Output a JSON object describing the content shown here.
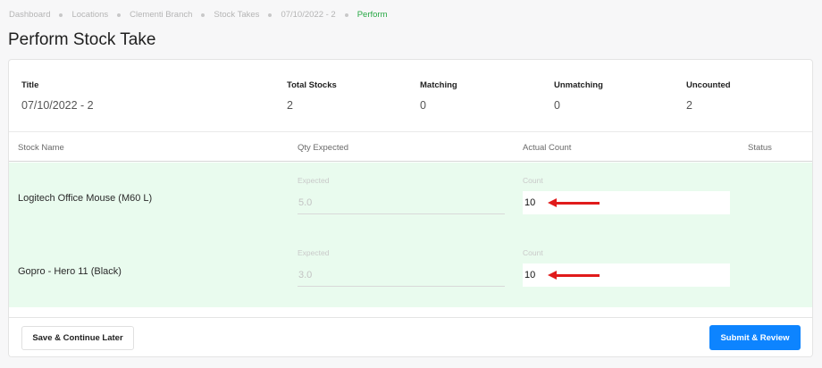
{
  "breadcrumb": [
    "Dashboard",
    "Locations",
    "Clementi Branch",
    "Stock Takes",
    "07/10/2022 - 2",
    "Perform"
  ],
  "page_title": "Perform Stock Take",
  "summary": {
    "title": {
      "label": "Title",
      "value": "07/10/2022 - 2"
    },
    "total": {
      "label": "Total Stocks",
      "value": "2"
    },
    "matching": {
      "label": "Matching",
      "value": "0"
    },
    "unmatching": {
      "label": "Unmatching",
      "value": "0"
    },
    "uncounted": {
      "label": "Uncounted",
      "value": "2"
    }
  },
  "table": {
    "headers": {
      "name": "Stock Name",
      "qty": "Qty Expected",
      "count": "Actual Count",
      "status": "Status"
    },
    "rows": [
      {
        "name": "Logitech Office Mouse (M60 L)",
        "expected_label": "Expected",
        "expected": "5.0",
        "count_label": "Count",
        "count": "10"
      },
      {
        "name": "Gopro - Hero 11 (Black)",
        "expected_label": "Expected",
        "expected": "3.0",
        "count_label": "Count",
        "count": "10"
      }
    ]
  },
  "footer": {
    "save_label": "Save & Continue Later",
    "submit_label": "Submit & Review"
  },
  "colors": {
    "row_bg": "#e9fbee",
    "accent": "#0d84ff",
    "breadcrumb_current": "#27a844",
    "arrow": "#e01b1b"
  }
}
